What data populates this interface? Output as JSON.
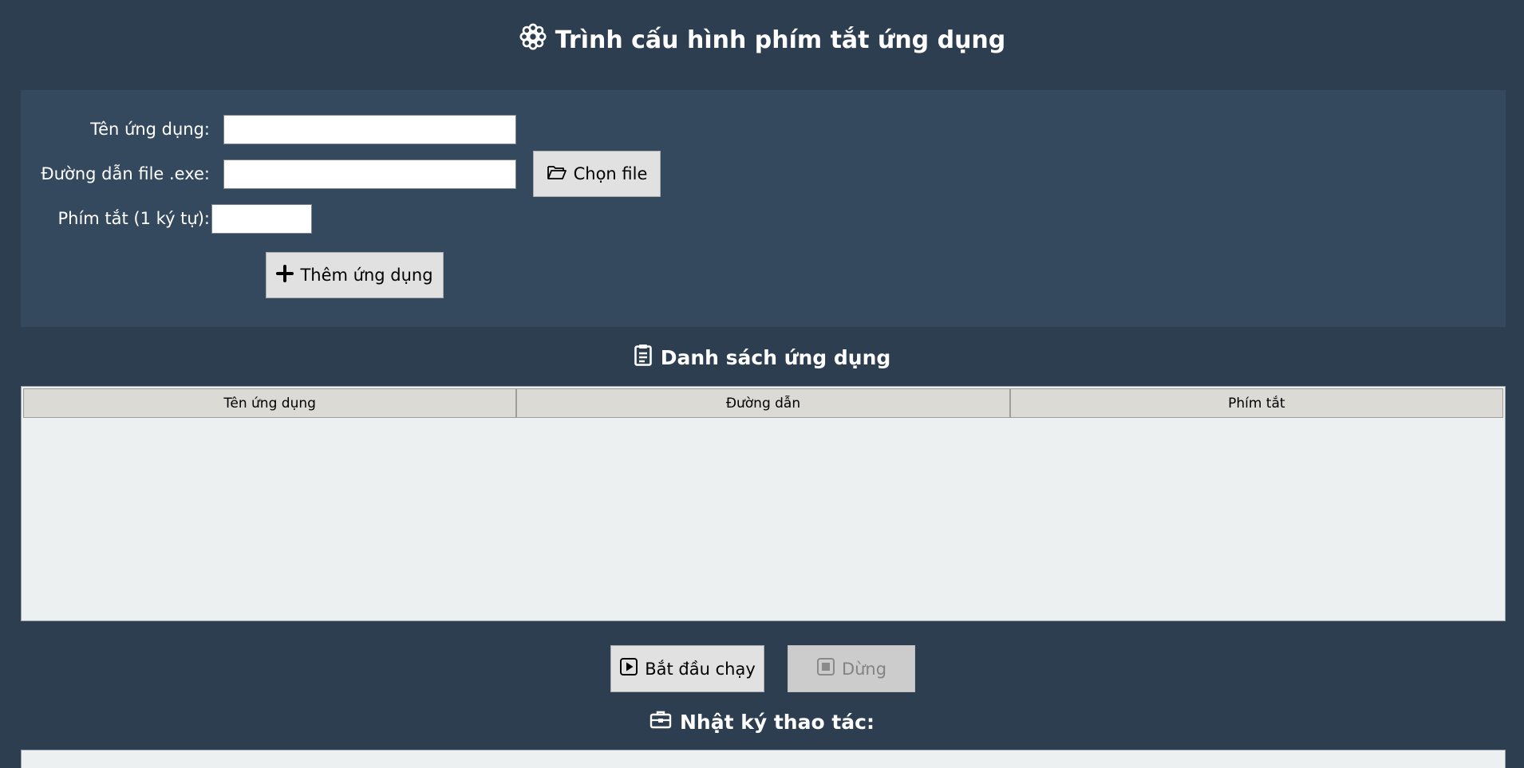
{
  "title": "Trình cấu hình phím tắt ứng dụng",
  "form": {
    "app_name_label": "Tên ứng dụng:",
    "app_name_value": "",
    "exe_path_label": "Đường dẫn file .exe:",
    "exe_path_value": "",
    "choose_file_label": "Chọn file",
    "hotkey_label": "Phím tắt (1 ký tự):",
    "hotkey_value": "",
    "add_app_label": "Thêm ứng dụng"
  },
  "app_list": {
    "title": "Danh sách ứng dụng",
    "columns": [
      "Tên ứng dụng",
      "Đường dẫn",
      "Phím tắt"
    ],
    "rows": []
  },
  "controls": {
    "start_label": "Bắt đầu chạy",
    "stop_label": "Dừng",
    "stop_enabled": false
  },
  "log": {
    "title": "Nhật ký thao tác:",
    "entries": []
  },
  "icons": {
    "title": "gear-icon",
    "choose_file": "folder-open-icon",
    "add_app": "plus-icon",
    "app_list": "clipboard-icon",
    "start": "play-icon",
    "stop": "stop-icon",
    "log": "toolbox-icon"
  },
  "colors": {
    "background": "#2c3e50",
    "panel": "#34495e",
    "table_bg": "#ecf0f1",
    "header_bg": "#dcdad5",
    "button_bg": "#e1e1e1"
  }
}
